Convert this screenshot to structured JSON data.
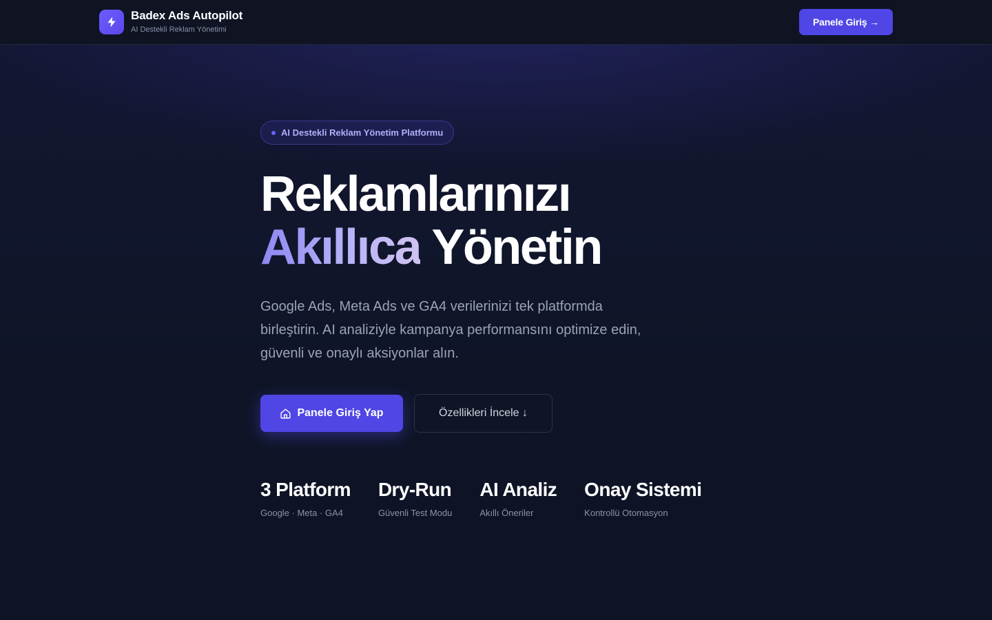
{
  "header": {
    "brand_title": "Badex Ads Autopilot",
    "brand_subtitle": "AI Destekli Reklam Yönetimi",
    "logo_icon": "lightning-bolt-icon",
    "cta_label": "Panele Giriş →"
  },
  "hero": {
    "badge": "AI Destekli Reklam Yönetim Platformu",
    "headline_line1": "Reklamlarınızı",
    "headline_accent": "Akıllıca",
    "headline_rest": "Yönetin",
    "description": "Google Ads, Meta Ads ve GA4 verilerinizi tek platformda birleştirin. AI analiziyle kampanya performansını optimize edin, güvenli ve onaylı aksiyonlar alın.",
    "primary_button": "Panele Giriş Yap",
    "primary_button_icon": "home-icon",
    "secondary_button": "Özellikleri İncele ↓"
  },
  "stats": [
    {
      "value": "3 Platform",
      "label": "Google · Meta · GA4"
    },
    {
      "value": "Dry-Run",
      "label": "Güvenli Test Modu"
    },
    {
      "value": "AI Analiz",
      "label": "Akıllı Öneriler"
    },
    {
      "value": "Onay Sistemi",
      "label": "Kontrollü Otomasyon"
    }
  ],
  "colors": {
    "accent": "#4f46e5",
    "background": "#0f1425",
    "gradient_text_start": "#8d87f3",
    "gradient_text_end": "#cfc3f2"
  }
}
